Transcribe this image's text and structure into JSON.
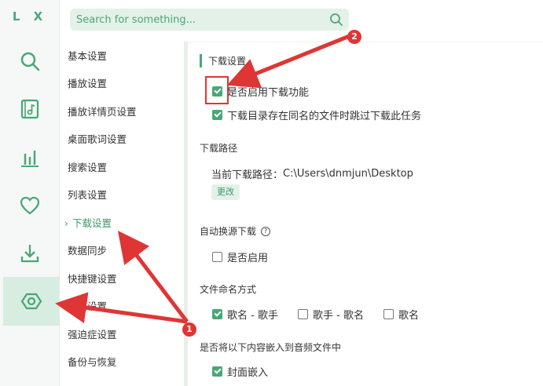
{
  "app": {
    "logo": "L X"
  },
  "search": {
    "placeholder": "Search for something..."
  },
  "rail": [
    {
      "icon": "search-icon"
    },
    {
      "icon": "music-list-icon"
    },
    {
      "icon": "chart-icon"
    },
    {
      "icon": "heart-icon"
    },
    {
      "icon": "download-icon"
    },
    {
      "icon": "settings-icon",
      "active": true
    }
  ],
  "nav": {
    "items": [
      {
        "label": "基本设置"
      },
      {
        "label": "播放设置"
      },
      {
        "label": "播放详情页设置"
      },
      {
        "label": "桌面歌词设置"
      },
      {
        "label": "搜索设置"
      },
      {
        "label": "列表设置"
      },
      {
        "label": "下载设置",
        "active": true
      },
      {
        "label": "数据同步"
      },
      {
        "label": "快捷键设置"
      },
      {
        "label": "网络设置"
      },
      {
        "label": "强迫症设置"
      },
      {
        "label": "备份与恢复"
      }
    ]
  },
  "content": {
    "section_title": "下载设置",
    "enable_download": "是否启用下载功能",
    "skip_existing": "下载目录存在同名的文件时跳过下载此任务",
    "path_title": "下载路径",
    "current_path_label": "当前下载路径：",
    "current_path": "C:\\Users\\dnmjun\\Desktop",
    "change_button": "更改",
    "auto_source_title": "自动换源下载",
    "auto_source_help": "?",
    "auto_source_enable": "是否启用",
    "naming_title": "文件命名方式",
    "naming_options": [
      "歌名 - 歌手",
      "歌手 - 歌名",
      "歌名"
    ],
    "embed_title": "是否将以下内容嵌入到音频文件中",
    "embed_cover": "封面嵌入"
  },
  "annotations": {
    "badge1": "1",
    "badge2": "2"
  },
  "colors": {
    "accent": "#4aa677",
    "annotation": "#e03535"
  }
}
